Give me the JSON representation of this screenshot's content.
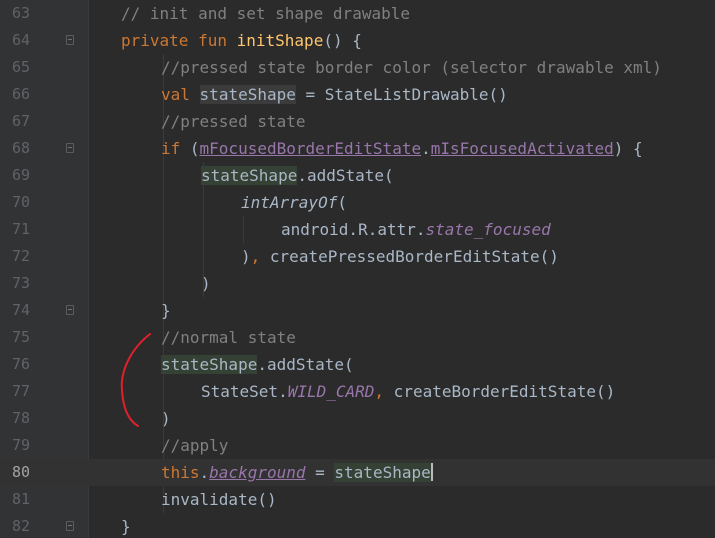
{
  "editor": {
    "lines": [
      {
        "num": "63"
      },
      {
        "num": "64"
      },
      {
        "num": "65"
      },
      {
        "num": "66"
      },
      {
        "num": "67"
      },
      {
        "num": "68"
      },
      {
        "num": "69"
      },
      {
        "num": "70"
      },
      {
        "num": "71"
      },
      {
        "num": "72"
      },
      {
        "num": "73"
      },
      {
        "num": "74"
      },
      {
        "num": "75"
      },
      {
        "num": "76"
      },
      {
        "num": "77"
      },
      {
        "num": "78"
      },
      {
        "num": "79"
      },
      {
        "num": "80"
      },
      {
        "num": "81"
      },
      {
        "num": "82"
      }
    ],
    "tokens": {
      "l63_comment": "// init and set shape drawable",
      "l64_private": "private",
      "l64_fun": "fun",
      "l64_name": "initShape",
      "l64_rest": "() {",
      "l65_comment": "//pressed state border color (selector drawable xml)",
      "l66_val": "val",
      "l66_var": "stateShape",
      "l66_rest": " = StateListDrawable()",
      "l67_comment": "//pressed state",
      "l68_if": "if",
      "l68_open": " (",
      "l68_ref1": "mFocusedBorderEditState",
      "l68_dot": ".",
      "l68_ref2": "mIsFocusedActivated",
      "l68_close": ") {",
      "l69_var": "stateShape",
      "l69_rest": ".addState(",
      "l70_fn": "intArrayOf",
      "l70_rest": "(",
      "l71_pre": "android.R.attr.",
      "l71_field": "state_focused",
      "l72_pre": ")",
      "l72_comma": ",",
      "l72_rest": " createPressedBorderEditState()",
      "l73_text": ")",
      "l74_text": "}",
      "l75_comment": "//normal state",
      "l76_var": "stateShape",
      "l76_rest": ".addState(",
      "l77_pre": "StateSet.",
      "l77_field": "WILD_CARD",
      "l77_comma": ",",
      "l77_rest": " createBorderEditState()",
      "l78_text": ")",
      "l79_comment": "//apply",
      "l80_this": "this",
      "l80_dot": ".",
      "l80_prop": "background",
      "l80_eq": " = ",
      "l80_var": "stateShape",
      "l81_text": "invalidate()",
      "l82_text": "}"
    },
    "current_line": "80"
  },
  "colors": {
    "background": "#2b2b2b",
    "keyword": "#cc7832",
    "function": "#ffc66d",
    "comment": "#808080",
    "field": "#9876aa",
    "text": "#a9b7c6",
    "annotation": "#e0202a"
  }
}
